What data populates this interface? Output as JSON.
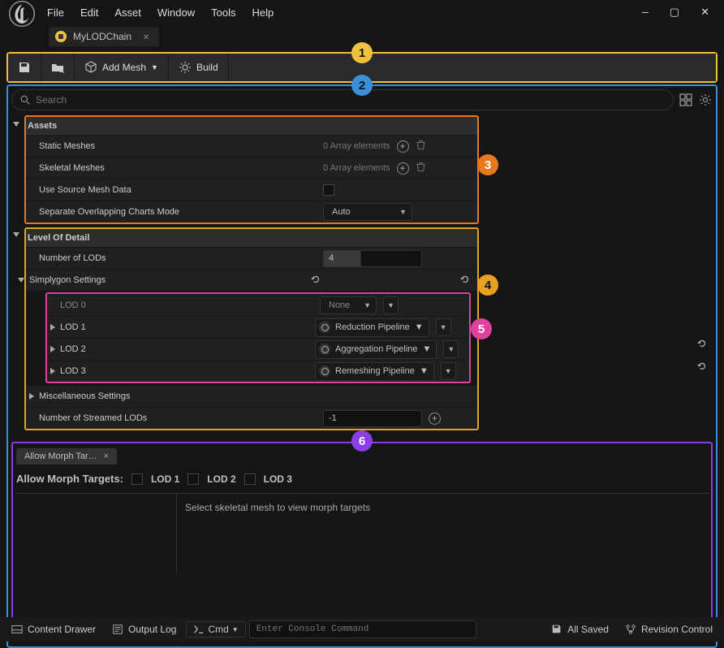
{
  "menu": {
    "items": [
      "File",
      "Edit",
      "Asset",
      "Window",
      "Tools",
      "Help"
    ]
  },
  "tab": {
    "title": "MyLODChain"
  },
  "toolbar": {
    "addMesh": "Add Mesh",
    "build": "Build"
  },
  "search": {
    "placeholder": "Search"
  },
  "sections": {
    "assets": {
      "title": "Assets",
      "staticMeshes": {
        "label": "Static Meshes",
        "value": "0 Array elements"
      },
      "skeletalMeshes": {
        "label": "Skeletal Meshes",
        "value": "0 Array elements"
      },
      "useSourceMeshData": {
        "label": "Use Source Mesh Data"
      },
      "separateCharts": {
        "label": "Separate Overlapping Charts Mode",
        "value": "Auto"
      }
    },
    "lod": {
      "title": "Level Of Detail",
      "numLods": {
        "label": "Number of LODs",
        "value": "4"
      },
      "simplygon": {
        "label": "Simplygon Settings"
      },
      "items": {
        "lod0": {
          "label": "LOD 0",
          "pipeline": "None"
        },
        "lod1": {
          "label": "LOD 1",
          "pipeline": "Reduction Pipeline"
        },
        "lod2": {
          "label": "LOD 2",
          "pipeline": "Aggregation Pipeline"
        },
        "lod3": {
          "label": "LOD 3",
          "pipeline": "Remeshing Pipeline"
        }
      },
      "misc": {
        "label": "Miscellaneous  Settings"
      },
      "streamed": {
        "label": "Number of Streamed LODs",
        "value": "-1"
      }
    }
  },
  "annotations": {
    "b1": "1",
    "b2": "2",
    "b3": "3",
    "b4": "4",
    "b5": "5",
    "b6": "6"
  },
  "morph": {
    "tab": "Allow Morph Tar…",
    "label": "Allow Morph Targets:",
    "l1": "LOD 1",
    "l2": "LOD 2",
    "l3": "LOD 3",
    "msg": "Select skeletal mesh to view morph targets"
  },
  "status": {
    "contentDrawer": "Content Drawer",
    "outputLog": "Output Log",
    "cmd": "Cmd",
    "cmdPlaceholder": "Enter Console Command",
    "allSaved": "All Saved",
    "revision": "Revision Control"
  }
}
